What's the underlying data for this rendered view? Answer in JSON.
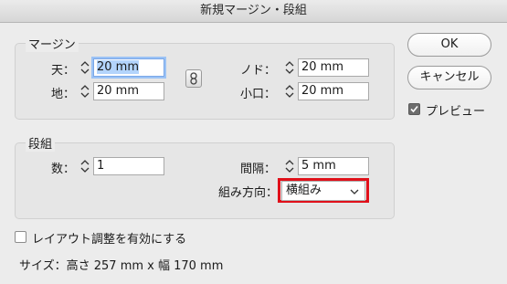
{
  "window": {
    "title": "新規マージン・段組"
  },
  "margin": {
    "legend": "マージン",
    "top_label": "天：",
    "top_value": "20 mm",
    "bottom_label": "地：",
    "bottom_value": "20 mm",
    "inside_label": "ノド：",
    "inside_value": "20 mm",
    "outside_label": "小口：",
    "outside_value": "20 mm"
  },
  "columns": {
    "legend": "段組",
    "count_label": "数：",
    "count_value": "1",
    "gutter_label": "間隔：",
    "gutter_value": "5 mm",
    "direction_label": "組み方向：",
    "direction_value": "横組み"
  },
  "layout_adjust_label": "レイアウト調整を有効にする",
  "size_text": "サイズ：高さ 257 mm x 幅 170 mm",
  "buttons": {
    "ok": "OK",
    "cancel": "キャンセル"
  },
  "preview": {
    "label": "プレビュー",
    "checked": true
  },
  "colors": {
    "highlight": "#e0101a",
    "focus": "#7aa7e8"
  }
}
